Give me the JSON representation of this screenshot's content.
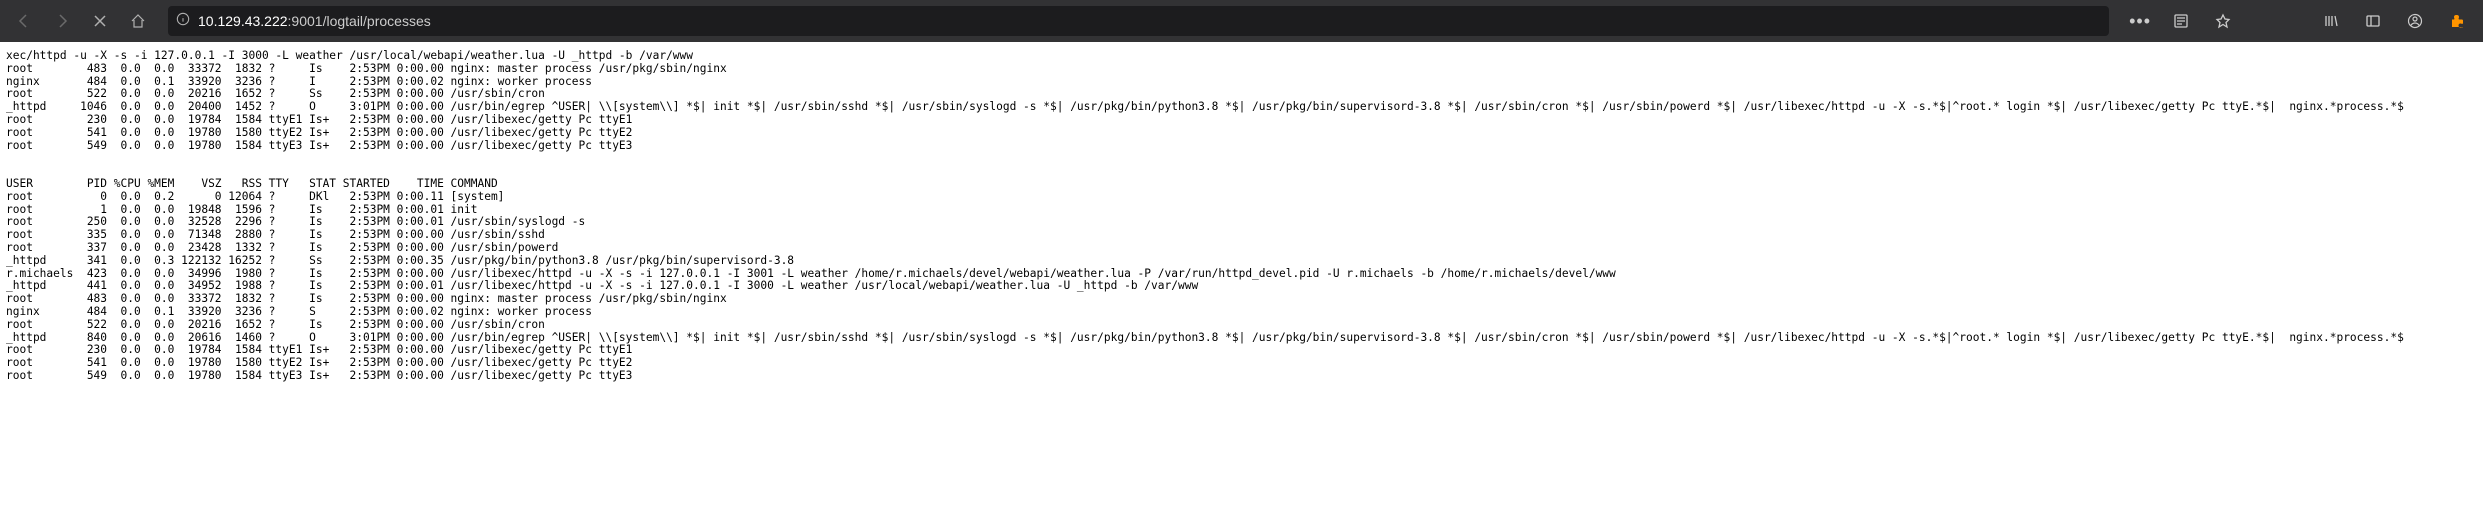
{
  "browser": {
    "url_prefix": "10.129.43.222",
    "url_path": ":9001/logtail/processes"
  },
  "log": {
    "frag_line": "xec/httpd -u -X -s -i 127.0.0.1 -I 3000 -L weather /usr/local/webapi/weather.lua -U _httpd -b /var/www",
    "top_rows": [
      {
        "user": "root",
        "pid": "483",
        "cpu": "0.0",
        "mem": "0.0",
        "vsz": "33372",
        "rss": "1832",
        "tty": "?",
        "stat": "Is",
        "started": "2:53PM",
        "time": "0:00.00",
        "cmd": "nginx: master process /usr/pkg/sbin/nginx"
      },
      {
        "user": "nginx",
        "pid": "484",
        "cpu": "0.0",
        "mem": "0.1",
        "vsz": "33920",
        "rss": "3236",
        "tty": "?",
        "stat": "I",
        "started": "2:53PM",
        "time": "0:00.02",
        "cmd": "nginx: worker process"
      },
      {
        "user": "root",
        "pid": "522",
        "cpu": "0.0",
        "mem": "0.0",
        "vsz": "20216",
        "rss": "1652",
        "tty": "?",
        "stat": "Ss",
        "started": "2:53PM",
        "time": "0:00.00",
        "cmd": "/usr/sbin/cron"
      },
      {
        "user": "_httpd",
        "pid": "1046",
        "cpu": "0.0",
        "mem": "0.0",
        "vsz": "20400",
        "rss": "1452",
        "tty": "?",
        "stat": "O",
        "started": "3:01PM",
        "time": "0:00.00",
        "cmd": "/usr/bin/egrep ^USER| \\\\[system\\\\] *$| init *$| /usr/sbin/sshd *$| /usr/sbin/syslogd -s *$| /usr/pkg/bin/python3.8 *$| /usr/pkg/bin/supervisord-3.8 *$| /usr/sbin/cron *$| /usr/sbin/powerd *$| /usr/libexec/httpd -u -X -s.*$|^root.* login *$| /usr/libexec/getty Pc ttyE.*$|  nginx.*process.*$"
      },
      {
        "user": "root",
        "pid": "230",
        "cpu": "0.0",
        "mem": "0.0",
        "vsz": "19784",
        "rss": "1584",
        "tty": "ttyE1",
        "stat": "Is+",
        "started": "2:53PM",
        "time": "0:00.00",
        "cmd": "/usr/libexec/getty Pc ttyE1"
      },
      {
        "user": "root",
        "pid": "541",
        "cpu": "0.0",
        "mem": "0.0",
        "vsz": "19780",
        "rss": "1580",
        "tty": "ttyE2",
        "stat": "Is+",
        "started": "2:53PM",
        "time": "0:00.00",
        "cmd": "/usr/libexec/getty Pc ttyE2"
      },
      {
        "user": "root",
        "pid": "549",
        "cpu": "0.0",
        "mem": "0.0",
        "vsz": "19780",
        "rss": "1584",
        "tty": "ttyE3",
        "stat": "Is+",
        "started": "2:53PM",
        "time": "0:00.00",
        "cmd": "/usr/libexec/getty Pc ttyE3"
      }
    ],
    "header": "USER        PID %CPU %MEM    VSZ   RSS TTY   STAT STARTED    TIME COMMAND",
    "bot_rows": [
      {
        "user": "root",
        "pid": "0",
        "cpu": "0.0",
        "mem": "0.2",
        "vsz": "0",
        "rss": "12064",
        "tty": "?",
        "stat": "DKl",
        "started": "2:53PM",
        "time": "0:00.11",
        "cmd": "[system]"
      },
      {
        "user": "root",
        "pid": "1",
        "cpu": "0.0",
        "mem": "0.0",
        "vsz": "19848",
        "rss": "1596",
        "tty": "?",
        "stat": "Is",
        "started": "2:53PM",
        "time": "0:00.01",
        "cmd": "init"
      },
      {
        "user": "root",
        "pid": "250",
        "cpu": "0.0",
        "mem": "0.0",
        "vsz": "32528",
        "rss": "2296",
        "tty": "?",
        "stat": "Is",
        "started": "2:53PM",
        "time": "0:00.01",
        "cmd": "/usr/sbin/syslogd -s"
      },
      {
        "user": "root",
        "pid": "335",
        "cpu": "0.0",
        "mem": "0.0",
        "vsz": "71348",
        "rss": "2880",
        "tty": "?",
        "stat": "Is",
        "started": "2:53PM",
        "time": "0:00.00",
        "cmd": "/usr/sbin/sshd"
      },
      {
        "user": "root",
        "pid": "337",
        "cpu": "0.0",
        "mem": "0.0",
        "vsz": "23428",
        "rss": "1332",
        "tty": "?",
        "stat": "Is",
        "started": "2:53PM",
        "time": "0:00.00",
        "cmd": "/usr/sbin/powerd"
      },
      {
        "user": "_httpd",
        "pid": "341",
        "cpu": "0.0",
        "mem": "0.3",
        "vsz": "122132",
        "rss": "16252",
        "tty": "?",
        "stat": "Ss",
        "started": "2:53PM",
        "time": "0:00.35",
        "cmd": "/usr/pkg/bin/python3.8 /usr/pkg/bin/supervisord-3.8"
      },
      {
        "user": "r.michaels",
        "pid": "423",
        "cpu": "0.0",
        "mem": "0.0",
        "vsz": "34996",
        "rss": "1980",
        "tty": "?",
        "stat": "Is",
        "started": "2:53PM",
        "time": "0:00.00",
        "cmd": "/usr/libexec/httpd -u -X -s -i 127.0.0.1 -I 3001 -L weather /home/r.michaels/devel/webapi/weather.lua -P /var/run/httpd_devel.pid -U r.michaels -b /home/r.michaels/devel/www"
      },
      {
        "user": "_httpd",
        "pid": "441",
        "cpu": "0.0",
        "mem": "0.0",
        "vsz": "34952",
        "rss": "1988",
        "tty": "?",
        "stat": "Is",
        "started": "2:53PM",
        "time": "0:00.01",
        "cmd": "/usr/libexec/httpd -u -X -s -i 127.0.0.1 -I 3000 -L weather /usr/local/webapi/weather.lua -U _httpd -b /var/www"
      },
      {
        "user": "root",
        "pid": "483",
        "cpu": "0.0",
        "mem": "0.0",
        "vsz": "33372",
        "rss": "1832",
        "tty": "?",
        "stat": "Is",
        "started": "2:53PM",
        "time": "0:00.00",
        "cmd": "nginx: master process /usr/pkg/sbin/nginx"
      },
      {
        "user": "nginx",
        "pid": "484",
        "cpu": "0.0",
        "mem": "0.1",
        "vsz": "33920",
        "rss": "3236",
        "tty": "?",
        "stat": "S",
        "started": "2:53PM",
        "time": "0:00.02",
        "cmd": "nginx: worker process"
      },
      {
        "user": "root",
        "pid": "522",
        "cpu": "0.0",
        "mem": "0.0",
        "vsz": "20216",
        "rss": "1652",
        "tty": "?",
        "stat": "Is",
        "started": "2:53PM",
        "time": "0:00.00",
        "cmd": "/usr/sbin/cron"
      },
      {
        "user": "_httpd",
        "pid": "840",
        "cpu": "0.0",
        "mem": "0.0",
        "vsz": "20616",
        "rss": "1460",
        "tty": "?",
        "stat": "O",
        "started": "3:01PM",
        "time": "0:00.00",
        "cmd": "/usr/bin/egrep ^USER| \\\\[system\\\\] *$| init *$| /usr/sbin/sshd *$| /usr/sbin/syslogd -s *$| /usr/pkg/bin/python3.8 *$| /usr/pkg/bin/supervisord-3.8 *$| /usr/sbin/cron *$| /usr/sbin/powerd *$| /usr/libexec/httpd -u -X -s.*$|^root.* login *$| /usr/libexec/getty Pc ttyE.*$|  nginx.*process.*$"
      },
      {
        "user": "root",
        "pid": "230",
        "cpu": "0.0",
        "mem": "0.0",
        "vsz": "19784",
        "rss": "1584",
        "tty": "ttyE1",
        "stat": "Is+",
        "started": "2:53PM",
        "time": "0:00.00",
        "cmd": "/usr/libexec/getty Pc ttyE1"
      },
      {
        "user": "root",
        "pid": "541",
        "cpu": "0.0",
        "mem": "0.0",
        "vsz": "19780",
        "rss": "1580",
        "tty": "ttyE2",
        "stat": "Is+",
        "started": "2:53PM",
        "time": "0:00.00",
        "cmd": "/usr/libexec/getty Pc ttyE2"
      },
      {
        "user": "root",
        "pid": "549",
        "cpu": "0.0",
        "mem": "0.0",
        "vsz": "19780",
        "rss": "1584",
        "tty": "ttyE3",
        "stat": "Is+",
        "started": "2:53PM",
        "time": "0:00.00",
        "cmd": "/usr/libexec/getty Pc ttyE3"
      }
    ]
  }
}
